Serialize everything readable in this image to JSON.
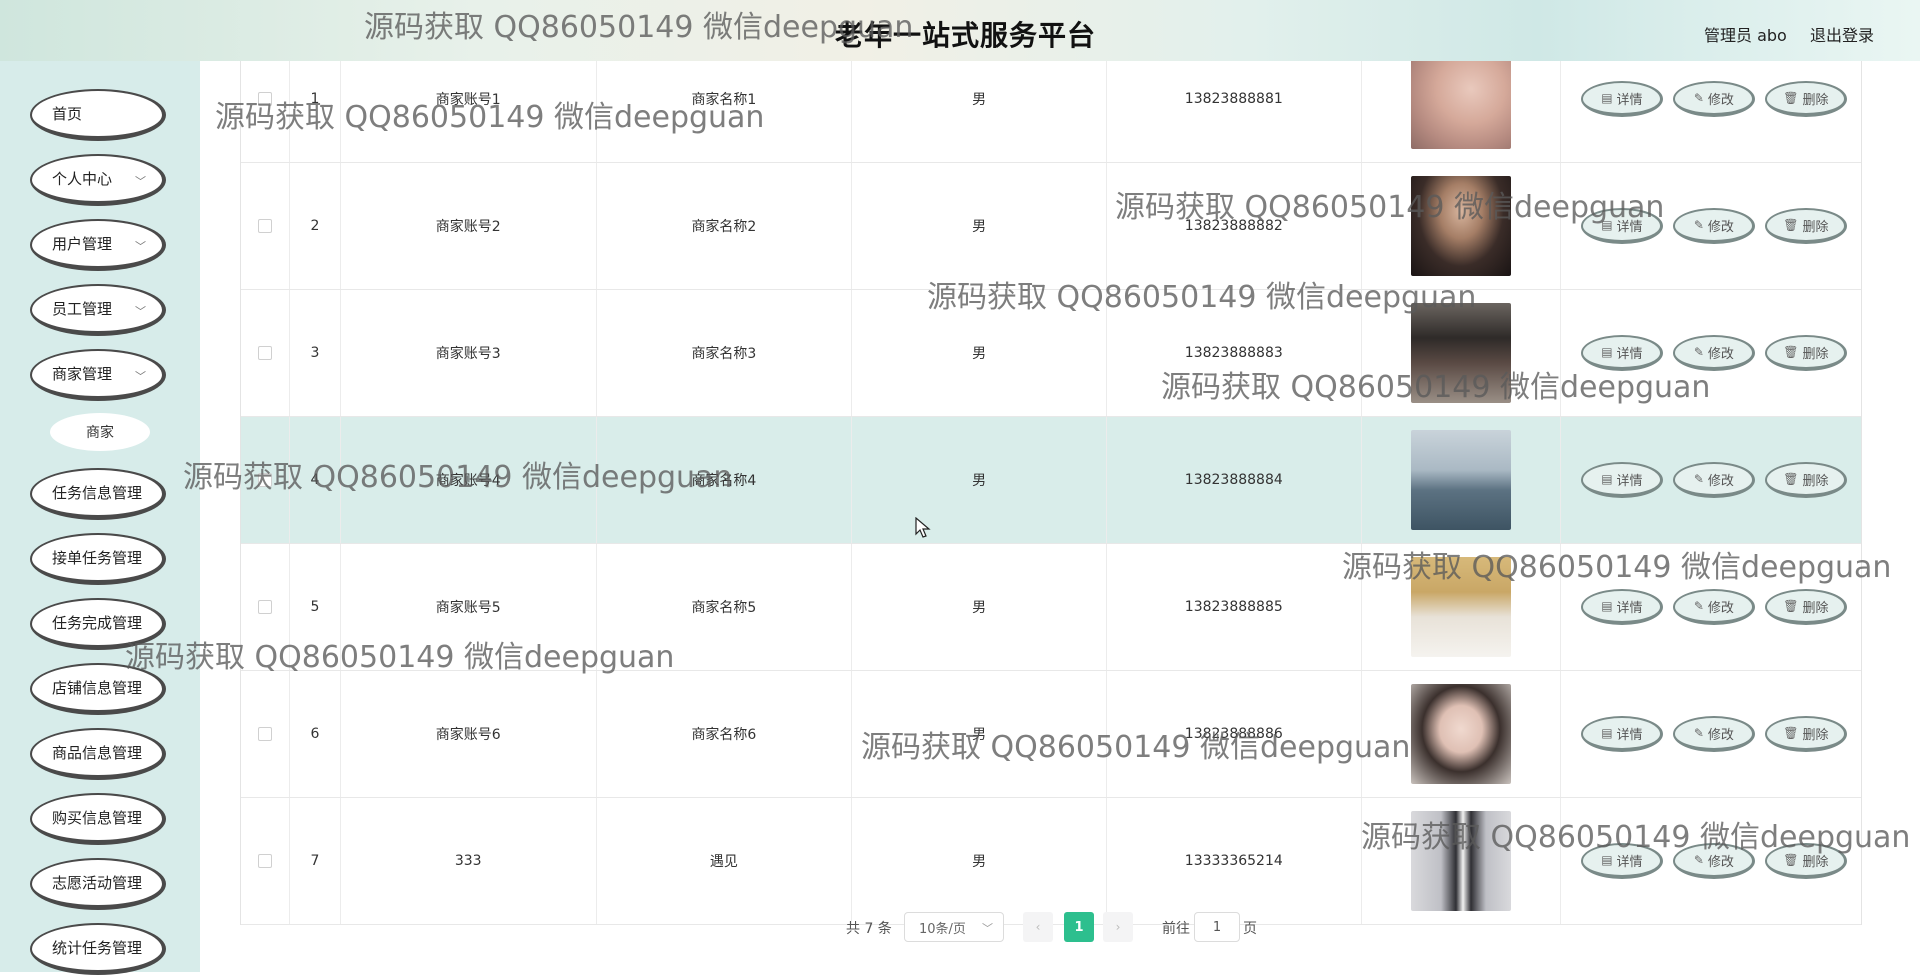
{
  "header": {
    "title": "老年一站式服务平台",
    "user": "管理员 abo",
    "logout": "退出登录"
  },
  "sidebar": {
    "items": [
      {
        "label": "首页",
        "expandable": false
      },
      {
        "label": "个人中心",
        "expandable": true
      },
      {
        "label": "用户管理",
        "expandable": true
      },
      {
        "label": "员工管理",
        "expandable": true
      },
      {
        "label": "商家管理",
        "expandable": true
      },
      {
        "label": "任务信息管理",
        "expandable": false
      },
      {
        "label": "接单任务管理",
        "expandable": false
      },
      {
        "label": "任务完成管理",
        "expandable": false
      },
      {
        "label": "店铺信息管理",
        "expandable": false
      },
      {
        "label": "商品信息管理",
        "expandable": false
      },
      {
        "label": "购买信息管理",
        "expandable": false
      },
      {
        "label": "志愿活动管理",
        "expandable": false
      },
      {
        "label": "统计任务管理",
        "expandable": false
      }
    ],
    "submenu": {
      "label": "商家"
    }
  },
  "table": {
    "rows": [
      {
        "index": "1",
        "account": "商家账号1",
        "name": "商家名称1",
        "sex": "男",
        "phone": "13823888881"
      },
      {
        "index": "2",
        "account": "商家账号2",
        "name": "商家名称2",
        "sex": "男",
        "phone": "13823888882"
      },
      {
        "index": "3",
        "account": "商家账号3",
        "name": "商家名称3",
        "sex": "男",
        "phone": "13823888883"
      },
      {
        "index": "4",
        "account": "商家账号4",
        "name": "商家名称4",
        "sex": "男",
        "phone": "13823888884"
      },
      {
        "index": "5",
        "account": "商家账号5",
        "name": "商家名称5",
        "sex": "男",
        "phone": "13823888885"
      },
      {
        "index": "6",
        "account": "商家账号6",
        "name": "商家名称6",
        "sex": "男",
        "phone": "13823888886"
      },
      {
        "index": "7",
        "account": "333",
        "name": "遇见",
        "sex": "男",
        "phone": "13333365214"
      }
    ],
    "actions": {
      "detail": "详情",
      "edit": "修改",
      "delete": "删除"
    },
    "highlighted_row": 4
  },
  "pagination": {
    "total": "共 7 条",
    "page_size": "10条/页",
    "current_page": "1",
    "goto_label": "前往",
    "goto_value": "1",
    "page_unit": "页"
  },
  "watermark": "源码获取 QQ86050149 微信deepguan",
  "colors": {
    "sidebar_bg": "#d7ecea",
    "row_highlight": "#d9edea",
    "pager_active": "#2dbf8e"
  }
}
